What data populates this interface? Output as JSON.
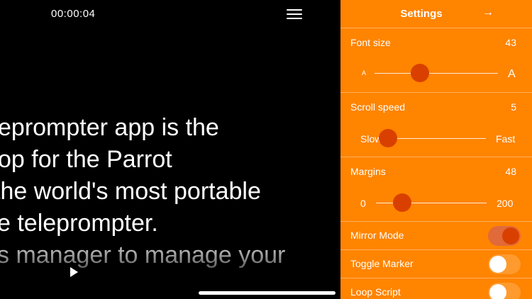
{
  "prompter": {
    "timer": "00:00:04",
    "script_lines": [
      "eprompter app is the",
      "op for the Parrot",
      " the world's most portable",
      "e teleprompter.",
      "s manager to manage your"
    ]
  },
  "settings": {
    "title": "Settings",
    "font_size": {
      "label": "Font size",
      "value": "43",
      "min_label": "A",
      "max_label": "A",
      "level": 0.37
    },
    "scroll_speed": {
      "label": "Scroll speed",
      "value": "5",
      "min_label": "Slow",
      "max_label": "Fast",
      "level": 0.0
    },
    "margins": {
      "label": "Margins",
      "value": "48",
      "min_label": "0",
      "max_label": "200",
      "level": 0.24
    },
    "mirror_mode": {
      "label": "Mirror Mode",
      "on": true
    },
    "toggle_marker": {
      "label": "Toggle Marker",
      "on": false
    },
    "loop_script": {
      "label": "Loop Script",
      "on": false
    }
  },
  "colors": {
    "panel": "#ff8400",
    "thumb": "#d94000",
    "background": "#000000"
  }
}
